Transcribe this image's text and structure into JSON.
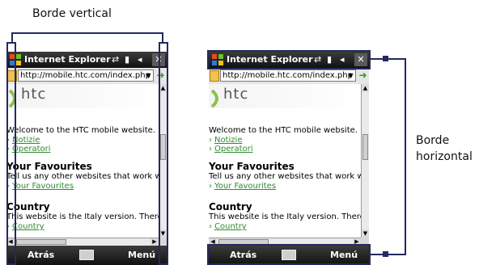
{
  "labels": {
    "vertical": "Borde vertical",
    "horizontal_line1": "Borde",
    "horizontal_line2": "horizontal"
  },
  "phone": {
    "title": "Internet Explorer",
    "close": "✕",
    "url": "http://mobile.htc.com/index.php",
    "logo": "htc",
    "welcome": "Welcome to the HTC mobile website. Here",
    "links1": [
      "Notizie",
      "Operatori"
    ],
    "favourites_heading": "Your Favourites",
    "favourites_text": "Tell us any other websites that work well",
    "favourites_link": "Your Favourites",
    "country_heading": "Country",
    "country_text": "This website is the Italy version. There are",
    "country_link": "Country",
    "softkey_left": "Atrás",
    "softkey_right": "Menú"
  },
  "colors": {
    "annotation": "#232a5e",
    "link": "#2e8b2e"
  },
  "icons": [
    "windows-start-icon",
    "connectivity-icon",
    "signal-icon",
    "volume-icon",
    "close-icon",
    "page-icon",
    "dropdown-icon",
    "go-icon",
    "keyboard-icon"
  ]
}
